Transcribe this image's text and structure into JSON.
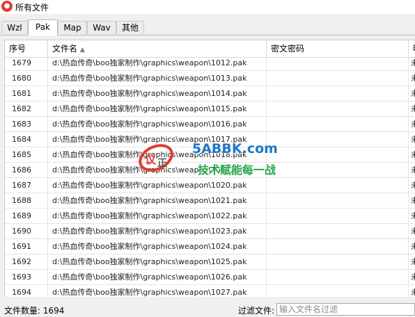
{
  "window": {
    "title": "所有文件",
    "icon": "app-logo-icon"
  },
  "tabs": [
    {
      "label": "Wzl",
      "active": false
    },
    {
      "label": "Pak",
      "active": true
    },
    {
      "label": "Map",
      "active": false
    },
    {
      "label": "Wav",
      "active": false
    },
    {
      "label": "其他",
      "active": false
    }
  ],
  "table": {
    "columns": [
      "序号",
      "文件名",
      "密文密码",
      "明"
    ],
    "sort_indicator": "▲",
    "rows": [
      {
        "no": "1679",
        "name": "d:\\热血传奇\\boo独家制作\\graphics\\weapon\\1012.pak",
        "password": "",
        "extra": "未"
      },
      {
        "no": "1680",
        "name": "d:\\热血传奇\\boo独家制作\\graphics\\weapon\\1013.pak",
        "password": "",
        "extra": "未"
      },
      {
        "no": "1681",
        "name": "d:\\热血传奇\\boo独家制作\\graphics\\weapon\\1014.pak",
        "password": "",
        "extra": "未"
      },
      {
        "no": "1682",
        "name": "d:\\热血传奇\\boo独家制作\\graphics\\weapon\\1015.pak",
        "password": "",
        "extra": "未"
      },
      {
        "no": "1683",
        "name": "d:\\热血传奇\\boo独家制作\\graphics\\weapon\\1016.pak",
        "password": "",
        "extra": "未"
      },
      {
        "no": "1684",
        "name": "d:\\热血传奇\\boo独家制作\\graphics\\weapon\\1017.pak",
        "password": "",
        "extra": "未"
      },
      {
        "no": "1685",
        "name": "d:\\热血传奇\\boo独家制作\\graphics\\weapon\\1018.pak",
        "password": "",
        "extra": "未"
      },
      {
        "no": "1686",
        "name": "d:\\热血传奇\\boo独家制作\\graphics\\weapon\\1019.pak",
        "password": "",
        "extra": "未"
      },
      {
        "no": "1687",
        "name": "d:\\热血传奇\\boo独家制作\\graphics\\weapon\\1020.pak",
        "password": "",
        "extra": "未"
      },
      {
        "no": "1688",
        "name": "d:\\热血传奇\\boo独家制作\\graphics\\weapon\\1021.pak",
        "password": "",
        "extra": "未"
      },
      {
        "no": "1689",
        "name": "d:\\热血传奇\\boo独家制作\\graphics\\weapon\\1022.pak",
        "password": "",
        "extra": "未"
      },
      {
        "no": "1690",
        "name": "d:\\热血传奇\\boo独家制作\\graphics\\weapon\\1023.pak",
        "password": "",
        "extra": "未"
      },
      {
        "no": "1691",
        "name": "d:\\热血传奇\\boo独家制作\\graphics\\weapon\\1024.pak",
        "password": "",
        "extra": "未"
      },
      {
        "no": "1692",
        "name": "d:\\热血传奇\\boo独家制作\\graphics\\weapon\\1025.pak",
        "password": "",
        "extra": "未"
      },
      {
        "no": "1693",
        "name": "d:\\热血传奇\\boo独家制作\\graphics\\weapon\\1026.pak",
        "password": "",
        "extra": "未"
      },
      {
        "no": "1694",
        "name": "d:\\热血传奇\\boo独家制作\\graphics\\weapon\\1027.pak",
        "password": "",
        "extra": "未"
      }
    ]
  },
  "status": {
    "count_label": "文件数量: 1694",
    "filter_label": "过滤文件:",
    "filter_placeholder": "输入文件名过滤",
    "filter_value": ""
  },
  "watermark": {
    "site": "5ABBK.com",
    "slogan": "技术赋能每一战",
    "colors": {
      "site": "#1d76c6",
      "slogan": "#25a84a",
      "logo_red": "#e03c31"
    }
  }
}
